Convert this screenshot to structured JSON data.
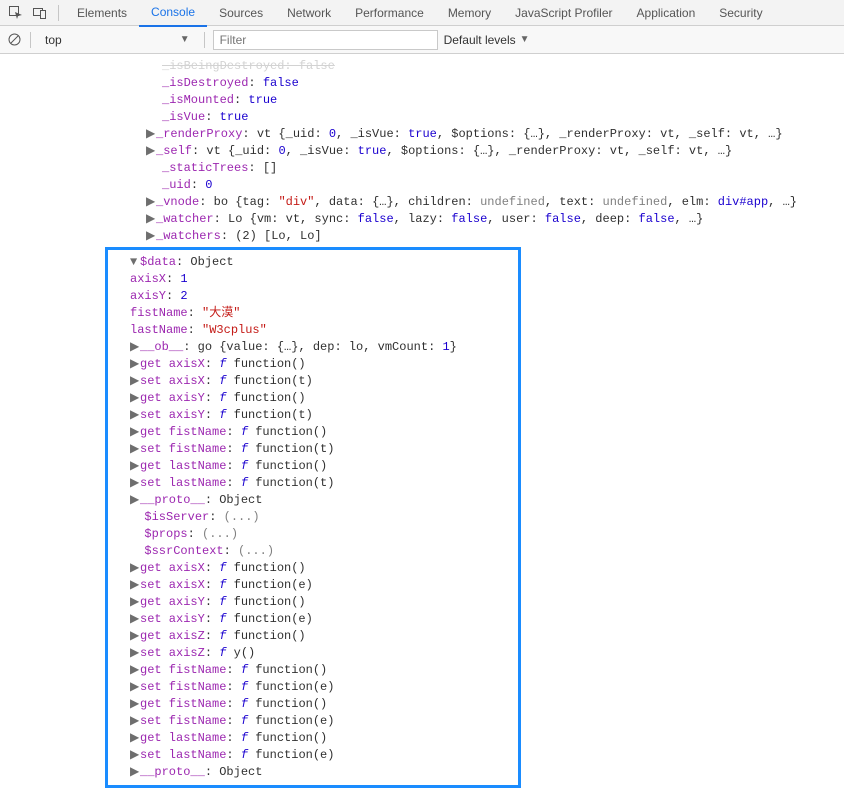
{
  "tabs": {
    "elements": "Elements",
    "console": "Console",
    "sources": "Sources",
    "network": "Network",
    "performance": "Performance",
    "memory": "Memory",
    "jsprofiler": "JavaScript Profiler",
    "application": "Application",
    "security": "Security"
  },
  "toolbar": {
    "context": "top",
    "filter_placeholder": "Filter",
    "levels": "Default levels"
  },
  "top_lines": {
    "l0": "_isBeingDestroyed: false",
    "l1_key": "_isDestroyed",
    "l1_val": "false",
    "l2_key": "_isMounted",
    "l2_val": "true",
    "l3_key": "_isVue",
    "l3_val": "true",
    "l4_key": "_renderProxy",
    "l4_body": "vt {_uid: 0, _isVue: true, $options: {…}, _renderProxy: vt, _self: vt, …}",
    "l5_key": "_self",
    "l5_body": "vt {_uid: 0, _isVue: true, $options: {…}, _renderProxy: vt, _self: vt, …}",
    "l6_key": "_staticTrees",
    "l6_body": "[]",
    "l7_key": "_uid",
    "l7_val": "0",
    "l8_key": "_vnode",
    "l8_preview": "bo {tag: \"div\", data: {…}, children: undefined, text: undefined, elm: div#app, …}",
    "l9_key": "_watcher",
    "l9_body": "Lo {vm: vt, sync: false, lazy: false, user: false, deep: false, …}",
    "l10_key": "_watchers",
    "l10_body": "(2) [Lo, Lo]"
  },
  "data_block": {
    "header_key": "$data",
    "header_val": "Object",
    "axisX_key": "axisX",
    "axisX_val": "1",
    "axisY_key": "axisY",
    "axisY_val": "2",
    "firstName_key": "fistName",
    "firstName_val": "\"大漠\"",
    "lastName_key": "lastName",
    "lastName_val": "\"W3cplus\"",
    "ob_key": "__ob__",
    "ob_body": "go {value: {…}, dep: lo, vmCount: 1}",
    "getset": [
      {
        "k": "get axisX",
        "args": "function()"
      },
      {
        "k": "set axisX",
        "args": "function(t)"
      },
      {
        "k": "get axisY",
        "args": "function()"
      },
      {
        "k": "set axisY",
        "args": "function(t)"
      },
      {
        "k": "get fistName",
        "args": "function()"
      },
      {
        "k": "set fistName",
        "args": "function(t)"
      },
      {
        "k": "get lastName",
        "args": "function()"
      },
      {
        "k": "set lastName",
        "args": "function(t)"
      }
    ],
    "proto_key": "__proto__",
    "proto_val": "Object",
    "isServer_key": "$isServer",
    "dots": "(...)",
    "props_key": "$props",
    "ssr_key": "$ssrContext",
    "outer_getset": [
      {
        "k": "get axisX",
        "args": "function()"
      },
      {
        "k": "set axisX",
        "args": "function(e)"
      },
      {
        "k": "get axisY",
        "args": "function()"
      },
      {
        "k": "set axisY",
        "args": "function(e)"
      },
      {
        "k": "get axisZ",
        "args": "function()"
      },
      {
        "k": "set axisZ",
        "args": "y()"
      },
      {
        "k": "get fistName",
        "args": "function()"
      },
      {
        "k": "set fistName",
        "args": "function(e)"
      },
      {
        "k": "get fistName",
        "args": "function()"
      },
      {
        "k": "set fistName",
        "args": "function(e)"
      },
      {
        "k": "get lastName",
        "args": "function()"
      },
      {
        "k": "set lastName",
        "args": "function(e)"
      }
    ]
  }
}
